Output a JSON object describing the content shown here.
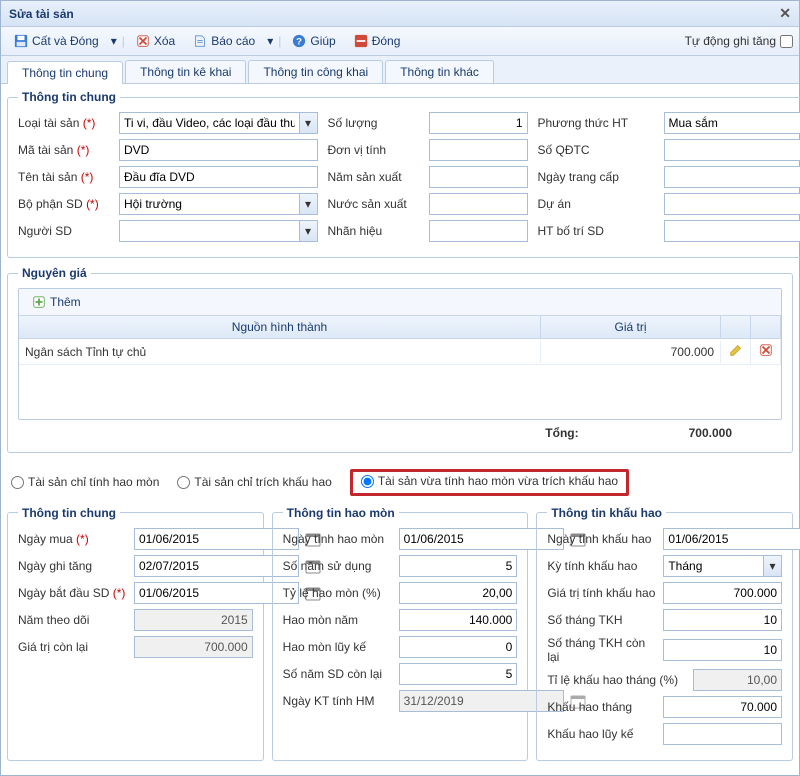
{
  "title": "Sửa tài sản",
  "toolbar": {
    "save": "Cất và Đóng",
    "delete": "Xóa",
    "report": "Báo cáo",
    "help": "Giúp",
    "close": "Đóng",
    "auto_inc": "Tự động ghi tăng"
  },
  "tabs": [
    "Thông tin chung",
    "Thông tin kê khai",
    "Thông tin công khai",
    "Thông tin khác"
  ],
  "active_tab": 0,
  "general": {
    "legend": "Thông tin chung",
    "asset_type_label": "Loại tài sản",
    "asset_type": "Ti vi, đầu Video, các loại đầu thu phát tín hiệu",
    "asset_code_label": "Mã tài sản",
    "asset_code": "DVD",
    "asset_name_label": "Tên tài sản",
    "asset_name": "Đầu đĩa DVD",
    "dept_label": "Bộ phận SD",
    "dept": "Hội trường",
    "user_label": "Người SD",
    "user": "",
    "qty_label": "Số lượng",
    "qty": "1",
    "unit_label": "Đơn vị tính",
    "unit": "",
    "mfg_year_label": "Năm sản xuất",
    "mfg_year": "",
    "country_label": "Nước sản xuất",
    "country": "",
    "brand_label": "Nhãn hiệu",
    "brand": "",
    "method_label": "Phương thức HT",
    "method": "Mua sắm",
    "decision_label": "Số QĐTC",
    "decision": "",
    "equip_date_label": "Ngày trang cấp",
    "equip_date": "",
    "project_label": "Dự án",
    "project": "",
    "layout_label": "HT bố trí SD",
    "layout": ""
  },
  "cost": {
    "legend": "Nguyên giá",
    "add": "Thêm",
    "col_src": "Nguồn hình thành",
    "col_val": "Giá trị",
    "rows": [
      {
        "src": "Ngân sách Tỉnh tự chủ",
        "val": "700.000"
      }
    ],
    "total_label": "Tổng:",
    "total": "700.000"
  },
  "radios": {
    "opt1": "Tài sản chỉ tính hao mòn",
    "opt2": "Tài sản chỉ trích khấu hao",
    "opt3": "Tài sản vừa tính hao mòn vừa trích khấu hao"
  },
  "ttc": {
    "legend": "Thông tin chung",
    "buy_date_label": "Ngày mua",
    "buy_date": "01/06/2015",
    "inc_date_label": "Ngày ghi tăng",
    "inc_date": "02/07/2015",
    "start_date_label": "Ngày bắt đầu SD",
    "start_date": "01/06/2015",
    "track_year_label": "Năm theo dõi",
    "track_year": "2015",
    "remain_label": "Giá trị còn lại",
    "remain": "700.000"
  },
  "hm": {
    "legend": "Thông tin hao mòn",
    "date_label": "Ngày tính hao mòn",
    "date": "01/06/2015",
    "years_label": "Số năm sử dụng",
    "years": "5",
    "rate_label": "Tỷ lệ hao mòn (%)",
    "rate": "20,00",
    "year_amt_label": "Hao mòn năm",
    "year_amt": "140.000",
    "acc_label": "Hao mòn lũy kế",
    "acc": "0",
    "years_left_label": "Số năm SD còn lại",
    "years_left": "5",
    "end_label": "Ngày KT tính HM",
    "end": "31/12/2019"
  },
  "kh": {
    "legend": "Thông tin khấu hao",
    "date_label": "Ngày tính khấu hao",
    "date": "01/06/2015",
    "period_label": "Kỳ tính khấu hao",
    "period": "Tháng",
    "basis_label": "Giá trị tính khấu hao",
    "basis": "700.000",
    "months_label": "Số tháng TKH",
    "months": "10",
    "months_left_label": "Số tháng TKH còn lại",
    "months_left": "10",
    "rate_label": "Tỉ lệ khấu hao tháng (%)",
    "rate": "10,00",
    "month_amt_label": "Khấu hao tháng",
    "month_amt": "70.000",
    "acc_label": "Khấu hao lũy kế",
    "acc": ""
  }
}
